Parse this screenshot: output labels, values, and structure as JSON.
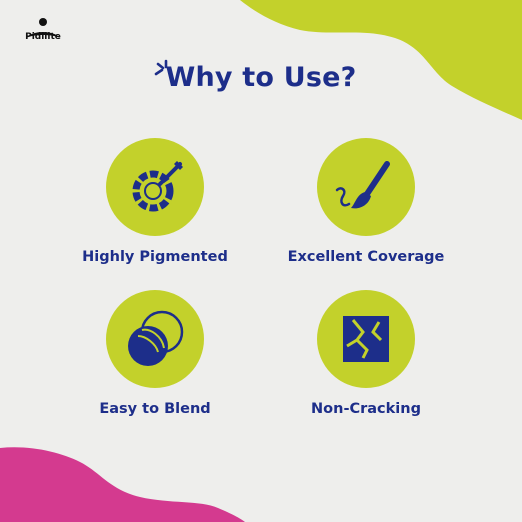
{
  "brand": {
    "name": "Pidilite",
    "icon": "pidilite-logo-icon"
  },
  "heading": {
    "title": "Why to Use?",
    "icon": "sparkle-icon"
  },
  "colors": {
    "accent_green": "#c3d12b",
    "navy": "#1d2e8a",
    "magenta": "#d43a8f",
    "background": "#eeeeec"
  },
  "features": [
    {
      "label": "Highly Pigmented",
      "icon": "palette-icon"
    },
    {
      "label": "Excellent Coverage",
      "icon": "paintbrush-icon"
    },
    {
      "label": "Easy to Blend",
      "icon": "blend-circles-icon"
    },
    {
      "label": "Non-Cracking",
      "icon": "cracked-tile-icon"
    }
  ]
}
